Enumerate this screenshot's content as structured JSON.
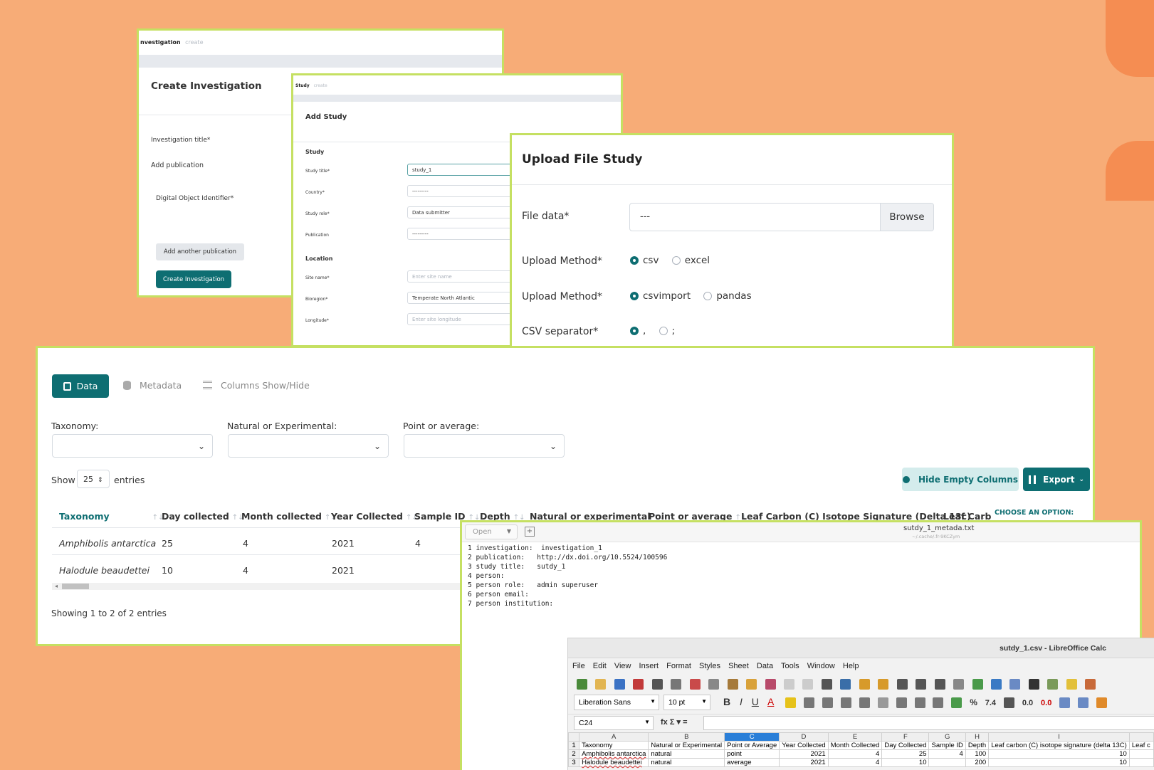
{
  "investigation_panel": {
    "breadcrumb_main": "nvestigation",
    "breadcrumb_sub": "create",
    "title": "Create Investigation",
    "field_title_label": "Investigation title*",
    "add_publication_label": "Add publication",
    "doi_label": "Digital Object Identifier*",
    "add_another_button": "Add another publication",
    "create_button": "Create Investigation"
  },
  "study_panel": {
    "breadcrumb_main": "Study",
    "breadcrumb_sub": "create",
    "title": "Add Study",
    "section_study": "Study",
    "fields": [
      {
        "label": "Study title*",
        "value": "study_1"
      },
      {
        "label": "Country*",
        "value": "---------"
      },
      {
        "label": "Study role*",
        "value": "Data submitter"
      },
      {
        "label": "Publication",
        "value": "---------"
      }
    ],
    "section_location": "Location",
    "location_fields": [
      {
        "label": "Site name*",
        "value": "Enter site name"
      },
      {
        "label": "Bioregion*",
        "value": "Temperate North Atlantic"
      },
      {
        "label": "Longitude*",
        "value": "Enter site longitude"
      }
    ]
  },
  "upload_panel": {
    "title": "Upload File Study",
    "file_label": "File data*",
    "file_value": "---",
    "browse_button": "Browse",
    "method1_label": "Upload Method*",
    "method1_options": [
      "csv",
      "excel"
    ],
    "method2_label": "Upload Method*",
    "method2_options": [
      "csvimport",
      "pandas"
    ],
    "separator_label": "CSV separator*",
    "separator_options": [
      ",",
      ";"
    ]
  },
  "data_panel": {
    "tabs": [
      "Data",
      "Metadata",
      "Columns Show/Hide"
    ],
    "filters": [
      "Taxonomy:",
      "Natural or Experimental:",
      "Point or average:"
    ],
    "show_label": "Show",
    "entries_value": "25",
    "entries_label": "entries",
    "hide_empty_button": "Hide Empty Columns",
    "export_button": "Export",
    "choose_option": "CHOOSE AN OPTION:",
    "columns": [
      "Taxonomy",
      "Day collected",
      "Month collected",
      "Year Collected",
      "Sample ID",
      "Depth",
      "Natural or experimental",
      "Point or average",
      "Leaf Carbon (C) Isotope Signature (Delta 13c)",
      "Leaf Carb"
    ],
    "rows": [
      {
        "taxonomy": "Amphibolis antarctica",
        "day": "25",
        "month": "4",
        "year": "2021",
        "sample": "4"
      },
      {
        "taxonomy": "Halodule beaudettei",
        "day": "10",
        "month": "4",
        "year": "2021",
        "sample": ""
      }
    ],
    "footer": "Showing 1 to 2 of 2 entries"
  },
  "text_editor": {
    "open_button": "Open",
    "filename": "sutdy_1_metada.txt",
    "path": "~/.cache/.fr-9KCZym",
    "lines": [
      {
        "n": "1",
        "key": "investigation:",
        "val": "investigation_1"
      },
      {
        "n": "2",
        "key": "publication:",
        "val": "http://dx.doi.org/10.5524/100596"
      },
      {
        "n": "3",
        "key": "study title:",
        "val": "sutdy_1"
      },
      {
        "n": "4",
        "key": "person:",
        "val": ""
      },
      {
        "n": "5",
        "key": "person role:",
        "val": "admin superuser"
      },
      {
        "n": "6",
        "key": "person email:",
        "val": ""
      },
      {
        "n": "7",
        "key": "person institution:",
        "val": ""
      }
    ]
  },
  "calc": {
    "title": "sutdy_1.csv - LibreOffice Calc",
    "menu": [
      "File",
      "Edit",
      "View",
      "Insert",
      "Format",
      "Styles",
      "Sheet",
      "Data",
      "Tools",
      "Window",
      "Help"
    ],
    "font_name": "Liberation Sans",
    "font_size": "10 pt",
    "cell_ref": "C24",
    "fx": "fx Σ ▾ =",
    "col_letters": [
      "A",
      "B",
      "C",
      "D",
      "E",
      "F",
      "G",
      "H",
      "I",
      "Leaf c"
    ],
    "header_row": [
      "Taxonomy",
      "Natural or Experimental",
      "Point or Average",
      "Year Collected",
      "Month Collected",
      "Day Collected",
      "Sample ID",
      "Depth",
      "Leaf carbon (C) isotope signature (delta 13C)",
      "Leaf c"
    ],
    "rows": [
      [
        "Amphibolis antarctica",
        "natural",
        "point",
        "2021",
        "4",
        "25",
        "4",
        "100",
        "10",
        ""
      ],
      [
        "Halodule beaudettei",
        "natural",
        "average",
        "2021",
        "4",
        "10",
        "",
        "200",
        "10",
        ""
      ]
    ]
  },
  "colors": {
    "background": "#F7AC77",
    "accent_shape": "#F58D52",
    "panel_border": "#C5E062",
    "teal": "#0E6E72"
  }
}
